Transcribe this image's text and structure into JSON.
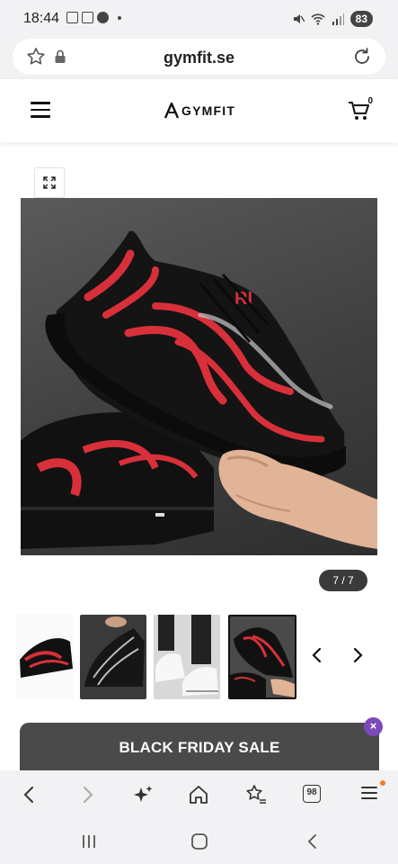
{
  "status_bar": {
    "time": "18:44",
    "battery": "83"
  },
  "url_bar": {
    "url": "gymfit.se"
  },
  "header": {
    "logo_text": "GYMFIT",
    "cart_count": "0"
  },
  "gallery": {
    "counter": "7 / 7",
    "thumbnails": [
      "black-red-sneaker",
      "black-white-sneaker",
      "white-sneaker",
      "black-red-sneaker-hand"
    ],
    "active_thumbnail": 4
  },
  "promo": {
    "label": "BLACK FRIDAY SALE",
    "close_icon": "×"
  },
  "browser_toolbar": {
    "tabs_count": "98"
  },
  "colors": {
    "accent_purple": "#7c4ab8",
    "promo_bg": "#4a4a4a",
    "shoe_red": "#d8303a"
  }
}
